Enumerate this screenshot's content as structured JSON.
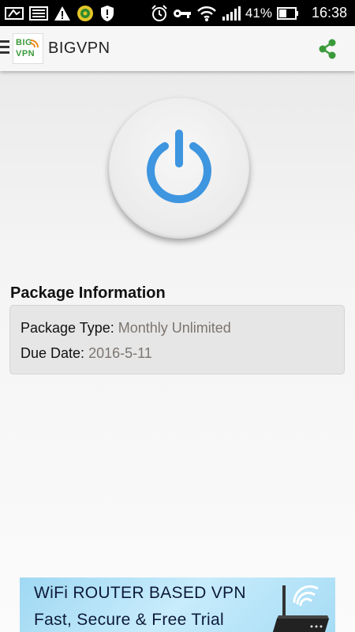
{
  "status_bar": {
    "battery_percent": "41%",
    "time": "16:38",
    "icons": [
      "screenshot-icon",
      "keyboard-icon",
      "warning-icon",
      "app-icon",
      "shield-icon",
      "alarm-icon",
      "vpn-key-icon",
      "wifi-icon",
      "signal-icon",
      "battery-icon"
    ]
  },
  "app_bar": {
    "title": "BIGVPN",
    "logo_line1": "BIG",
    "logo_line2": "VPN",
    "accent": "#3a9a3a"
  },
  "power": {
    "color": "#3e95e0"
  },
  "package": {
    "heading": "Package Information",
    "type_label": "Package Type:",
    "type_value": "Monthly Unlimited",
    "due_label": "Due Date:",
    "due_value": "2016-5-11"
  },
  "banner": {
    "line1": "WiFi ROUTER BASED VPN",
    "line2": "Fast,  Secure & Free Trial"
  }
}
